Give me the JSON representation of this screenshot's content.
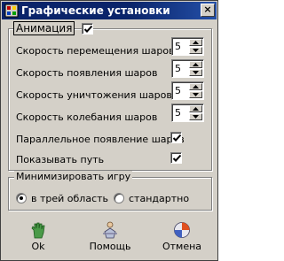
{
  "window": {
    "title": "Графические установки",
    "close_glyph": "×",
    "icon": "app-settings-icon"
  },
  "animation": {
    "legend": "Анимация",
    "enabled": true,
    "speeds": [
      {
        "label": "Скорость перемещения шаров",
        "value": "5"
      },
      {
        "label": "Скорость появления шаров",
        "value": "5"
      },
      {
        "label": "Скорость уничтожения шаров",
        "value": "5"
      },
      {
        "label": "Скорость колебания шаров",
        "value": "5"
      }
    ],
    "parallel_label": "Параллельное появление шаров",
    "parallel_checked": true,
    "show_path_label": "Показывать путь",
    "show_path_checked": true
  },
  "minimize": {
    "legend": "Минимизировать игру",
    "options": [
      {
        "label": "в трей область",
        "selected": true
      },
      {
        "label": "стандартно",
        "selected": false
      }
    ]
  },
  "buttons": {
    "ok": "Ok",
    "help": "Помощь",
    "cancel": "Отмена"
  },
  "colors": {
    "title_bar": "#0a246a",
    "face": "#d4d0c8",
    "ok_icon": "#3c8c3c",
    "cancel_icon": "#e05020"
  }
}
